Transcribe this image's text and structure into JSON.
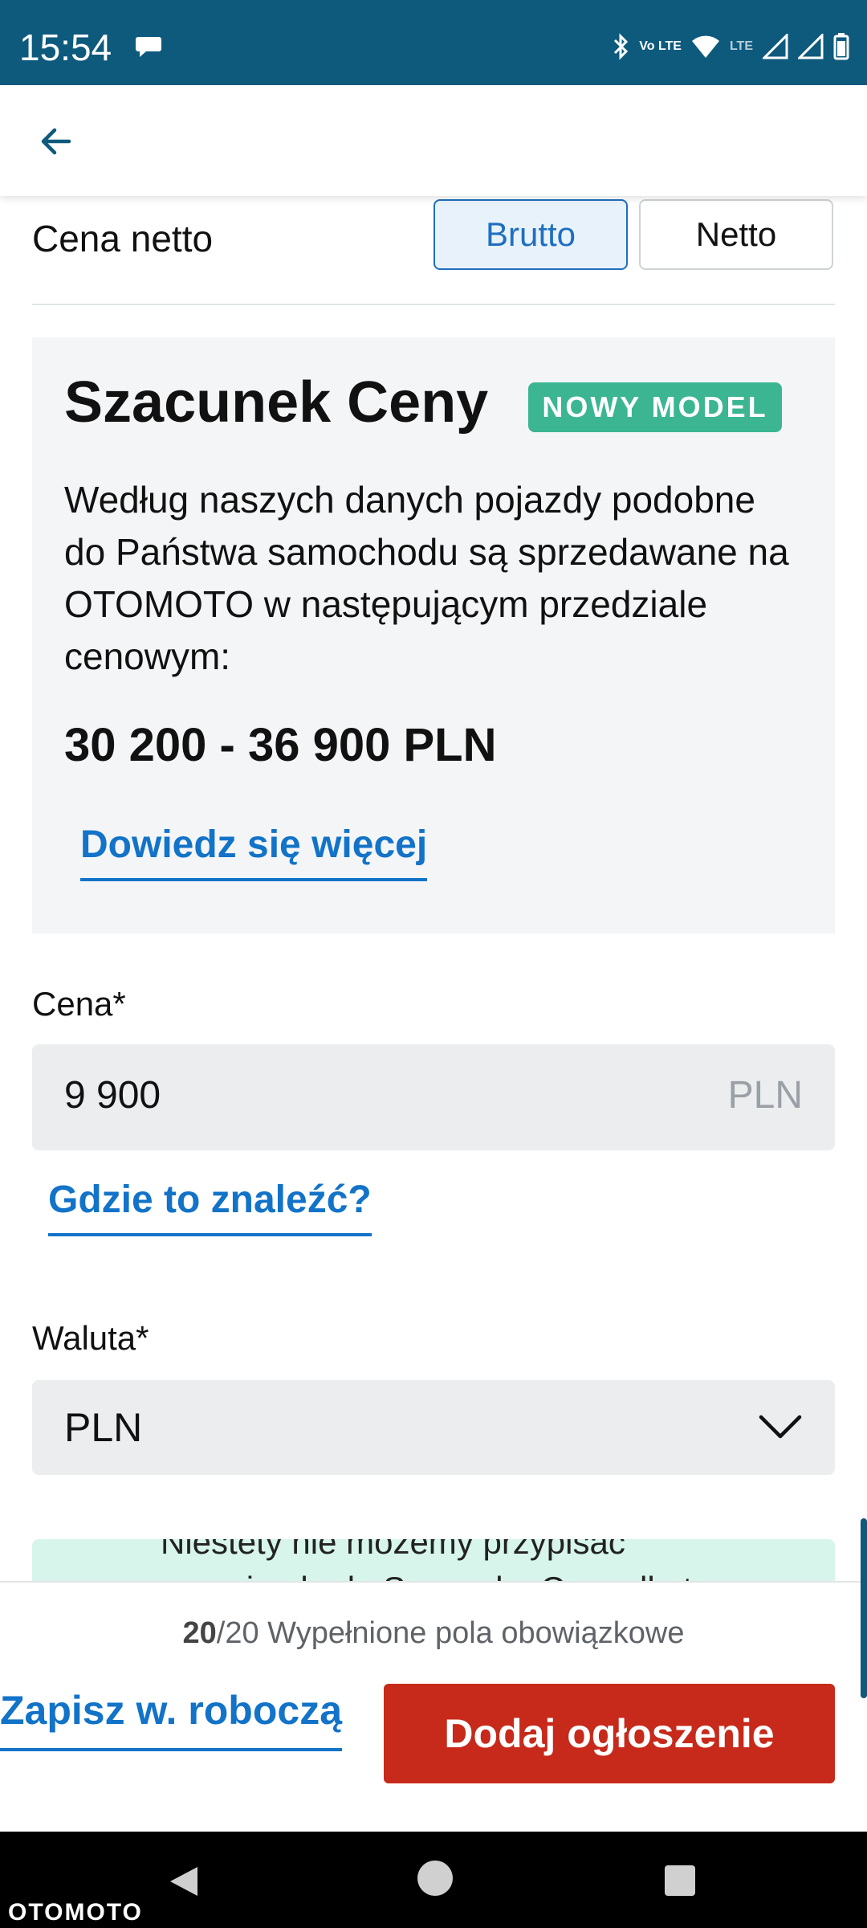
{
  "status_bar": {
    "time": "15:54",
    "icons": [
      "chat-bubble-icon",
      "bluetooth-icon",
      "volte-icon",
      "wifi-icon",
      "signal-icon",
      "signal-icon",
      "battery-icon"
    ],
    "volte_text": "Vo LTE",
    "lte_text": "LTE"
  },
  "app_bar": {
    "back_icon": "arrow-left-icon"
  },
  "price_type": {
    "label": "Cena netto",
    "options": [
      "Brutto",
      "Netto"
    ],
    "selected": "Brutto"
  },
  "estimate": {
    "title": "Szacunek Ceny",
    "badge": "NOWY MODEL",
    "description": "Według naszych danych pojazdy podobne do Państwa samochodu są sprzedawane na OTOMOTO w następującym przedziale cenowym:",
    "range": "30 200 - 36 900 PLN",
    "link": "Dowiedz się więcej"
  },
  "price": {
    "label": "Cena*",
    "value": "9 900",
    "unit": "PLN",
    "help_link": "Gdzie to znaleźć?"
  },
  "currency": {
    "label": "Waluta*",
    "value": "PLN"
  },
  "info_banner": {
    "line1": "Niestety nie możemy przypisać",
    "line2": "pojazdu do Szacunku Ceny dla t..."
  },
  "bottom": {
    "progress_done": "20",
    "progress_rest": "/20 Wypełnione pola obowiązkowe",
    "draft_button": "Zapisz w. roboczą",
    "publish_button": "Dodaj ogłoszenie"
  },
  "watermark": "OTOMOTO",
  "colors": {
    "status_bar": "#0e5a7d",
    "link_blue": "#1273c8",
    "badge_green": "#3bb592",
    "publish_red": "#c7291a"
  }
}
